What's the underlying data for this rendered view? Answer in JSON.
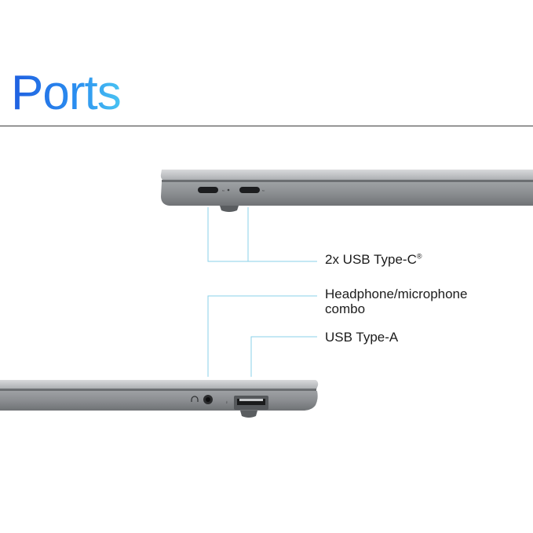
{
  "title": "Ports",
  "labels": {
    "usb_c": "2x USB Type-C",
    "usb_c_mark": "®",
    "headphone": "Headphone/microphone",
    "headphone_line2": "combo",
    "usb_a": "USB Type-A"
  },
  "colors": {
    "title_gradient_start": "#1f5fe0",
    "title_gradient_end": "#49c3f2",
    "callout_line": "#8ad0ea",
    "laptop_body": "#8e9194"
  }
}
